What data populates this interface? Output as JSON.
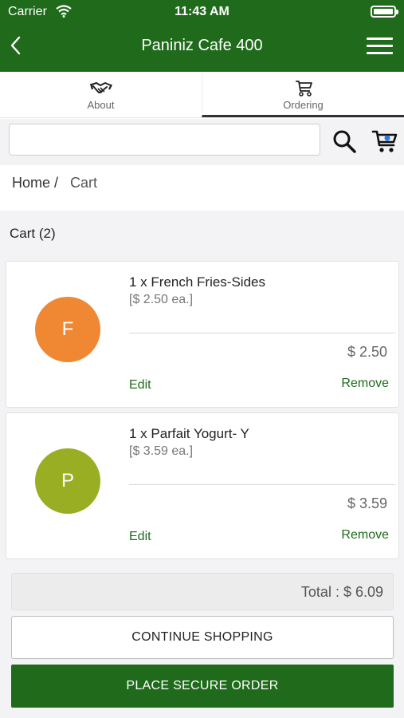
{
  "status_bar": {
    "carrier": "Carrier",
    "time": "11:43 AM"
  },
  "nav": {
    "title": "Paniniz Cafe 400",
    "back_icon": "chevron-left-icon",
    "menu_icon": "hamburger-icon"
  },
  "tabs": [
    {
      "label": "About",
      "icon": "handshake-icon",
      "active": false
    },
    {
      "label": "Ordering",
      "icon": "cart-icon",
      "active": true
    }
  ],
  "search": {
    "value": "",
    "placeholder": ""
  },
  "breadcrumb": {
    "home": "Home /",
    "current": "Cart"
  },
  "cart": {
    "header": "Cart (2)",
    "items": [
      {
        "initial": "F",
        "name": "1 x French Fries-Sides",
        "unit_price": "[$ 2.50 ea.]",
        "line_total": "$ 2.50",
        "edit_label": "Edit",
        "remove_label": "Remove"
      },
      {
        "initial": "P",
        "name": "1 x Parfait Yogurt- Y",
        "unit_price": "[$ 3.59 ea.]",
        "line_total": "$ 3.59",
        "edit_label": "Edit",
        "remove_label": "Remove"
      }
    ],
    "total": "Total : $ 6.09"
  },
  "buttons": {
    "continue": "CONTINUE SHOPPING",
    "place": "PLACE SECURE ORDER"
  },
  "colors": {
    "brand_green": "#1f6b1b",
    "avatar_f": "#ef8733",
    "avatar_p": "#9aae24"
  }
}
